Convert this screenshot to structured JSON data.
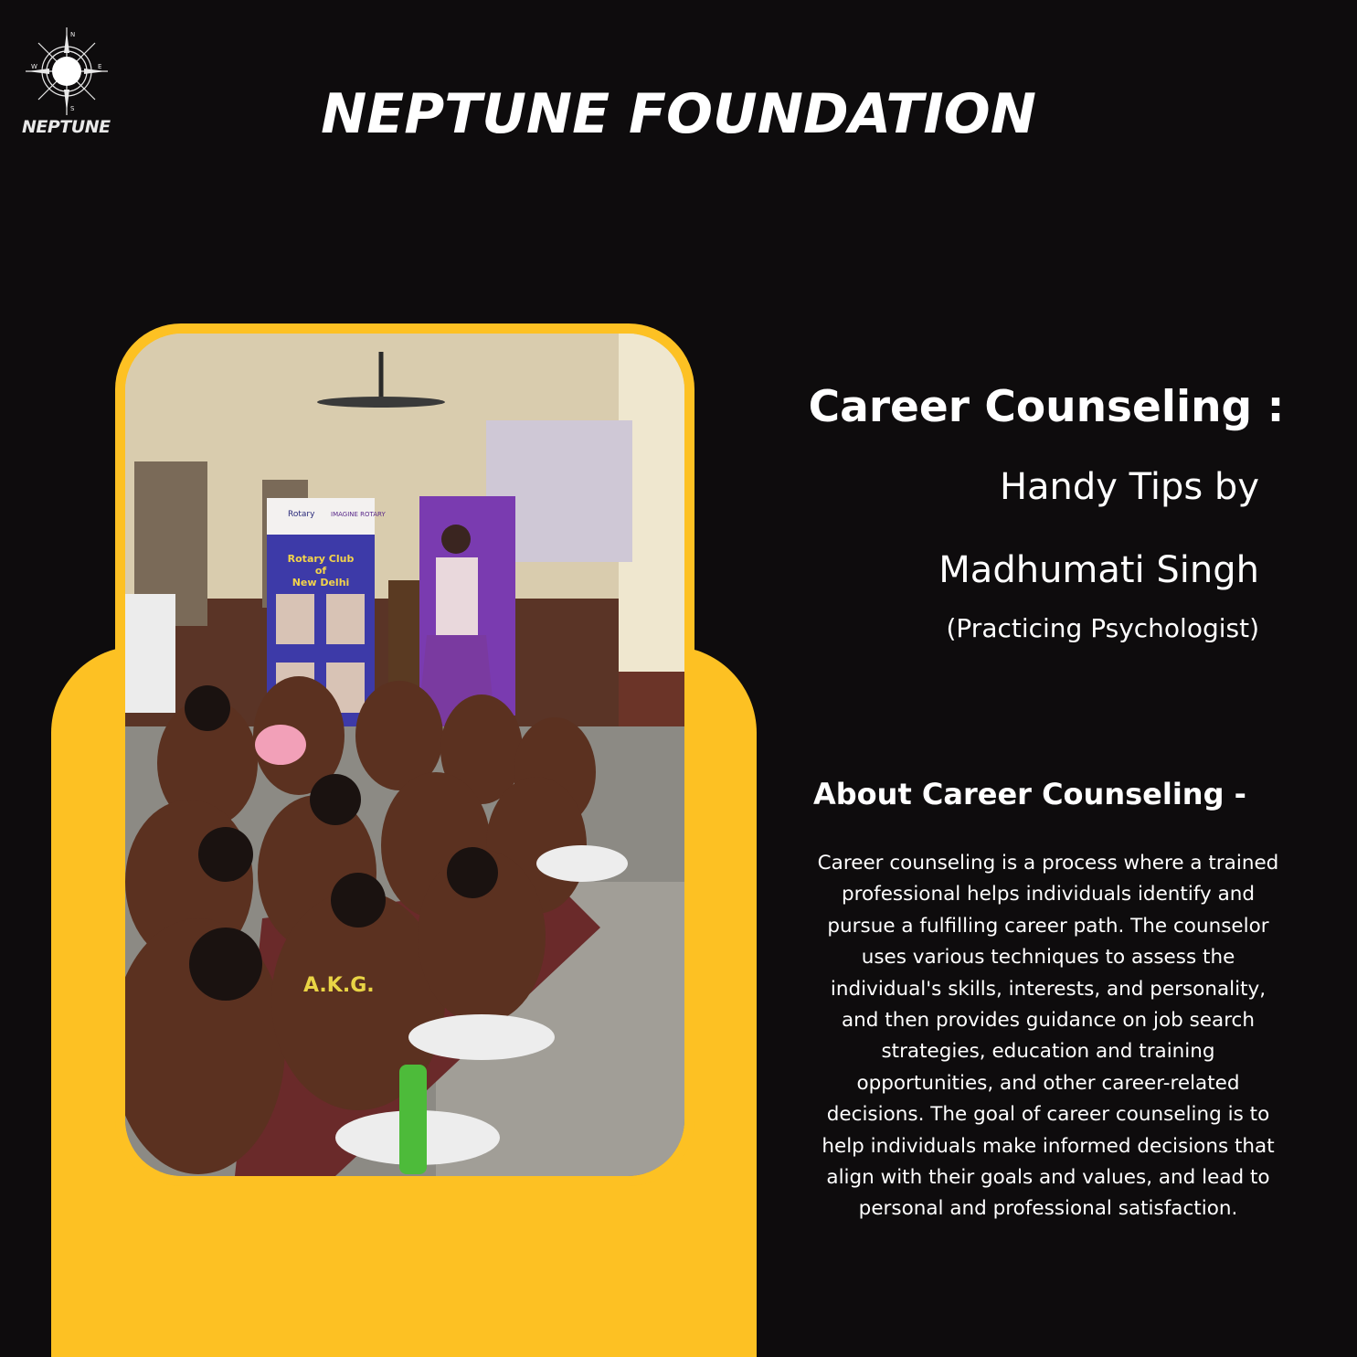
{
  "brand": {
    "logo_text": "NEPTUNE",
    "compass_letters": [
      "N",
      "S",
      "E",
      "W"
    ]
  },
  "header": {
    "title": "NEPTUNE FOUNDATION"
  },
  "photo": {
    "description_icon": "photo-of-classroom-session",
    "banner_lines": [
      "Rotary",
      "IMAGINE ROTARY",
      "Rotary Club",
      "of",
      "New Delhi"
    ],
    "hoodie_text": "A.K.G."
  },
  "intro": {
    "heading": "Career Counseling :",
    "subtitle_line1": "Handy Tips by",
    "subtitle_line2": "Madhumati Singh",
    "subtitle_line3": "(Practicing Psychologist)"
  },
  "about": {
    "heading": "About Career Counseling -",
    "body": "Career counseling is a process where a trained professional helps individuals identify and pursue a fulfilling career path. The counselor uses various techniques to assess the individual's skills, interests, and personality, and then provides guidance on job search strategies, education and training opportunities, and other career-related decisions. The goal of career counseling is to help individuals make informed decisions that align with their goals and values, and lead to personal and professional satisfaction."
  },
  "colors": {
    "background": "#0e0c0d",
    "accent": "#fdc123",
    "text": "#ffffff"
  }
}
